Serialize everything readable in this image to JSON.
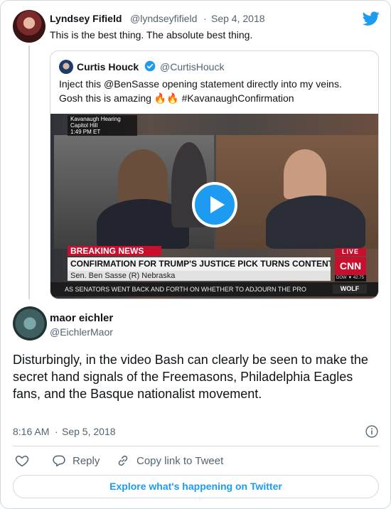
{
  "tweet": {
    "display_name": "Lyndsey Fifield",
    "handle": "@lyndseyfifield",
    "separator": "·",
    "date": "Sep 4, 2018",
    "text": "This is the best thing. The absolute best thing."
  },
  "quoted_tweet": {
    "display_name": "Curtis Houck",
    "handle": "@CurtisHouck",
    "verified": true,
    "text_line1": "Inject this @BenSasse opening statement directly into my veins.",
    "text_line2": "Gosh this is amazing 🔥🔥 #KavanaughConfirmation",
    "video": {
      "overlay_label_1": "Kavanaugh Hearing",
      "overlay_label_2": "Capitol Hill",
      "overlay_time": "1:49 PM ET",
      "breaking": "BREAKING NEWS",
      "live": "LIVE",
      "headline": "CONFIRMATION FOR TRUMP'S JUSTICE PICK TURNS CONTENTIOUS",
      "network": "CNN",
      "name_strip": "Sen. Ben Sasse   (R) Nebraska",
      "dow": "DOW ▼ 42.75",
      "ticker": "AS SENATORS WENT BACK AND FORTH ON WHETHER TO ADJOURN THE PRO",
      "show_tag": "WOLF",
      "play_icon": "play-icon"
    }
  },
  "reply": {
    "display_name": "maor eichler",
    "handle": "@EichlerMaor",
    "text": "Disturbingly, in the video Bash can clearly be seen to make the secret hand signals of the Freemasons, Philadelphia Eagles fans, and the Basque nationalist movement.",
    "time": "8:16 AM",
    "separator": "·",
    "date": "Sep 5, 2018"
  },
  "actions": {
    "like_icon": "heart-icon",
    "reply_label": "Reply",
    "copy_label": "Copy link to Tweet"
  },
  "explore_label": "Explore what's happening on Twitter",
  "colors": {
    "accent": "#1d9bf0",
    "text": "#0f1419",
    "secondary": "#536471",
    "border": "#cfd9de",
    "cnn_red": "#c8102e"
  }
}
